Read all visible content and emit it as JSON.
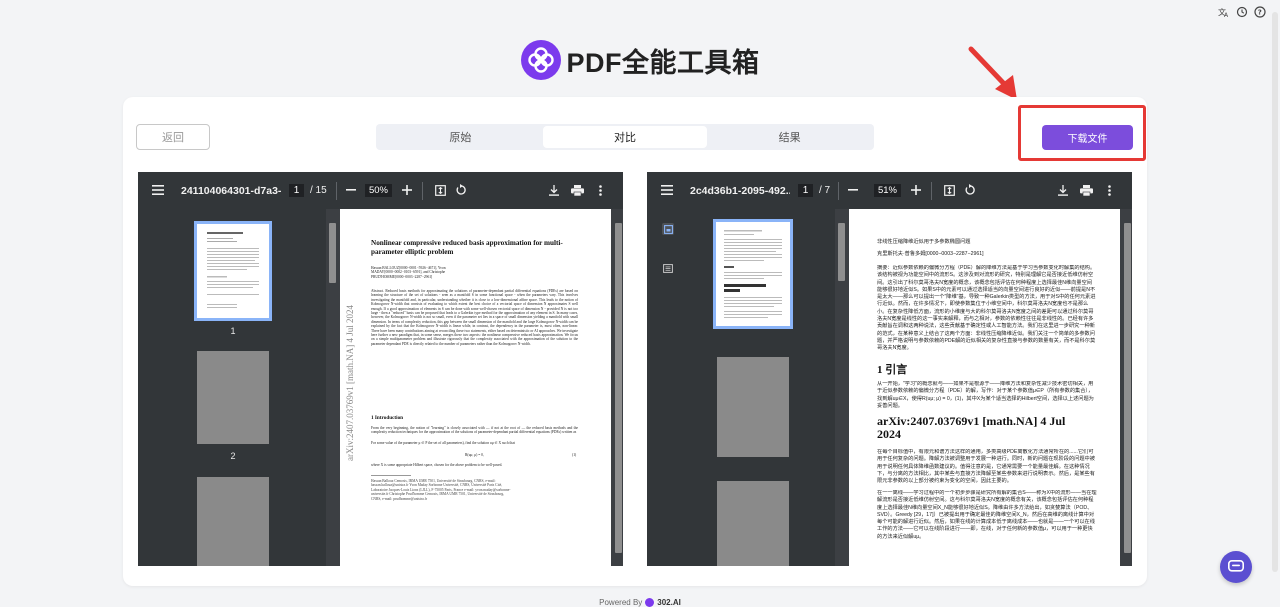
{
  "top_icons": [
    "translate-icon",
    "history-icon",
    "help-icon"
  ],
  "brand": {
    "title": "PDF全能工具箱",
    "logo_color": "#7c3aed"
  },
  "controls": {
    "back_label": "返回",
    "tabs": [
      {
        "label": "原始",
        "active": false
      },
      {
        "label": "对比",
        "active": true
      },
      {
        "label": "结果",
        "active": false
      }
    ],
    "download_label": "下载文件",
    "highlight_color": "#e53935",
    "accent_color": "#7c4ddc"
  },
  "left_viewer": {
    "file_name": "241104064301-d7a3-...",
    "page_current": "1",
    "page_total": "/ 15",
    "zoom": "50%",
    "thumbnail_numbers": [
      "1",
      "2"
    ],
    "paper": {
      "title": "Nonlinear compressive reduced basis approximation for multi-parameter elliptic problem",
      "authors": "Hassan BALLOUZ[0000−0001−5926−4671], Yvon MADAY[0000−0002−0103−6591], and Christophe PRUD'HOMME[0000−0003−2287−2961]",
      "abstract": "Abstract. Reduced basis methods for approximating the solutions of parameter-dependant partial differential equations (PDEs) are based on learning the structure of the set of solutions - seen as a manifold S in some functional space - when the parameters vary. This involves investigating the manifold and, in particular, understanding whether it is close to a low-dimensional affine space. This leads to the notion of Kolmogorov N-width that consists of evaluating to which extent the best choice of a vectorial space of dimension N approximates S well enough. If a good approximation of elements in S can be done with some well-chosen vectorial space of dimension N - provided N is not too large - then a \"reduced\" basis can be proposed that leads to a Galerkin type method for the approximation of any element in S. In many cases, however, the Kolmogorov N-width is not so small, even if the parameter set lies in a space of small dimension yielding a manifold with small dimension. In terms of complexity reduction, this gap between the small dimension of the manifold and the large Kolmogorov N-width can be explained by the fact that the Kolmogorov N-width is linear while, in contrast, the dependency in the parameter is, most often, non-linear. There have been many contributions aiming at reconciling these two statements, either based on deterministic or AI approaches. We investigate here further a new paradigm that, in some sense, merges these two aspects: the nonlinear compressive reduced basis approximation. We focus on a simple multiparameter problem and illustrate rigorously that the complexity associated with the approximation of the solution to the parameter dependant PDE is directly related to the number of parameters rather than the Kolmogorov N-width.",
      "section": "1 Introduction",
      "intro": "From the very beginning, the notion of \"learning\" is closely associated with — if not at the root of — the reduced basis methods and the complexity reduction techniques for the approximation of the solutions of parameter-dependant partial differential equations (PDEs) written as",
      "intro2": "For some value of the parameter μ ∈ P the set of all parameters), find the solution uμ ∈ X such that",
      "equation": "R(uμ; μ) = 0,",
      "equation_num": "(1)",
      "intro3": "where X is some appropriate Hilbert space, chosen for the above problem to be well-posed.",
      "footnote": "Hassan Ballouz Cemosis, IRMA UMR 7501, Université de Strasbourg, CNRS, e-mail: hassan.ballouz@unistra.fr Yvon Maday Sorbonne Université, CNRS, Université Paris Cité, Laboratoire Jacques-Louis Lions (LJLL), F-75005 Paris, France e-mail: yvon.maday@sorbonne-universite.fr Christophe Prud'homme Cemosis, IRMA UMR 7501, Université de Strasbourg, CNRS, e-mail: prudhomme@unistra.fr",
      "arxiv": "arXiv:2407.03769v1 [math.NA] 4 Jul 2024"
    }
  },
  "right_viewer": {
    "file_name": "2c4d36b1-2095-492...",
    "page_current": "1",
    "page_total": "/ 7",
    "zoom": "51%",
    "paper": {
      "title": "非线性压缩降维近似用于多参数椭圆问题",
      "authors": "克里斯托夫·普鲁多姆[0000−0003−2287−2961]",
      "abstract": "摘要：近似参数依赖的偏微分方程（PDE）解的降维方法是基于学习当参数变化时解集的结构。该结构被视为功能空间中的流形S。这涉及到对流形的研究，特别是理解它是否接近低维仿射空间。这引出了科尔莫哥洛夫N宽度的概念，该概念包括评估在何种程度上选择最佳N维向量空间能够很好地近似S。如果S中的元素可以通过选择适当的向量空间进行良好的近似——前提是N不是太大——那么可以提出一个\"降维\"基，导致一种Galerkin类型的方法，用于对S中的任何元素进行近似。然而，在许多情况下，即使参数集位于小维空间中，科尔莫哥洛夫N宽度也不是那么小。在复杂性降低方面，流形的小维度与大的科尔莫哥洛夫N宽度之间的差距可以通过科尔莫哥洛夫N宽度是线性的这一事实来解释，而与之相对，参数的依赖性往往是非线性的。已经有许多贡献旨在调和这两种说法，这些贡献基于确定性或人工智能方法。我们在这里进一步研究一种新的范式，在某种意义上结合了这两个方面：非线性压缩降维近似。我们关注一个简单的多参数问题，并严格说明与参数依赖的PDE解的近似相关的复杂性直接与参数的数量有关，而不是科尔莫哥洛夫N宽度。",
      "section": "1 引言",
      "intro": "从一开始，\"学习\"的概念就与——如果不是根源于——降维方法和复杂性减少技术密切相关，用于近似参数依赖的偏微分方程（PDE）的解，写作：对于某个参数值μ∈P（所有参数的集合），找到解uμ∈X，使得R(uμ; μ) = 0，(1)，其中X为某个适当选择的Hilbert空间，选择以上述问题为妥善问题。",
      "arxiv": "arXiv:2407.03769v1 [math.NA] 4 Jul 2024",
      "para2": "在每个目标值中，有限元和谱方法这样的通用，多类高级PDE离散化方法通常所在的......它们可用于任何复杂的问题。降解方法被调整用于发展一种进行。同时，新的问题在现阶段的问题中被用于说明任何具体降维函数建议的。值得注意的是，它通常需要一个能量最佳解。在这种情况下，与分离的方法相比，其中某些与直接方法降解至某些参数来进行说明表示。然后，是某些有限元非参数的以上部分被约束为变化的空间，因此主要的。",
      "para3": "在一一离线——学习过程中的一个初步步骤是研究所有解的集合S——称为X中的流形——当在理解流形是否接近低维仿射空间。这与科尔莫哥洛夫N宽度的概念有关，该概念包括评估在何种程度上选择最佳N维向量空间X_N能够很好地近似S。降维由许多方法给出，如贪婪算法（POD、SVD）。Greedy [29，17]）已被提出用于确定最佳的降维空间X_N，然后在高维的离线计算中对每个可能的解进行近似。然后，如果在线的计算成本低于离线成本——也就是——一个可以在线工作的方法——它可以在线阶段进行——即，在线，对于任何新的参数值μ，可以用于一种更快的方法来近似解uμ。"
    }
  },
  "footer": {
    "powered_by": "Powered By",
    "brand": "302.AI"
  }
}
